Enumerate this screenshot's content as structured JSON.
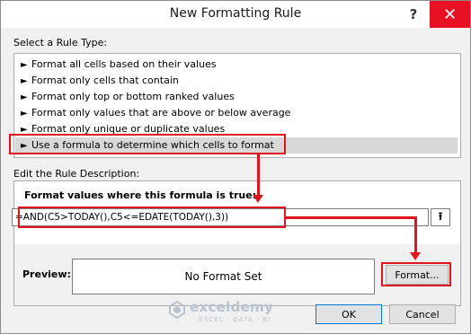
{
  "window": {
    "title": "New Formatting Rule",
    "help": "?",
    "close": "✕"
  },
  "rule_type": {
    "label": "Select a Rule Type:",
    "items": [
      {
        "label": "Format all cells based on their values",
        "selected": false
      },
      {
        "label": "Format only cells that contain",
        "selected": false
      },
      {
        "label": "Format only top or bottom ranked values",
        "selected": false
      },
      {
        "label": "Format only values that are above or below average",
        "selected": false
      },
      {
        "label": "Format only unique or duplicate values",
        "selected": false
      },
      {
        "label": "Use a formula to determine which cells to format",
        "selected": true
      }
    ]
  },
  "description": {
    "label": "Edit the Rule Description:",
    "formula_label": "Format values where this formula is true:",
    "formula_value": "=AND(C5>TODAY(),C5<=EDATE(TODAY(),3))",
    "preview_label": "Preview:",
    "preview_text": "No Format Set",
    "format_button": "Format..."
  },
  "buttons": {
    "ok": "OK",
    "cancel": "Cancel"
  },
  "watermark": {
    "name": "exceldemy",
    "tagline": "EXCEL · DATA · BI"
  },
  "colors": {
    "annotation_red": "#e0141e",
    "close_red": "#e81123",
    "selection_gray": "#d8d8d8"
  }
}
